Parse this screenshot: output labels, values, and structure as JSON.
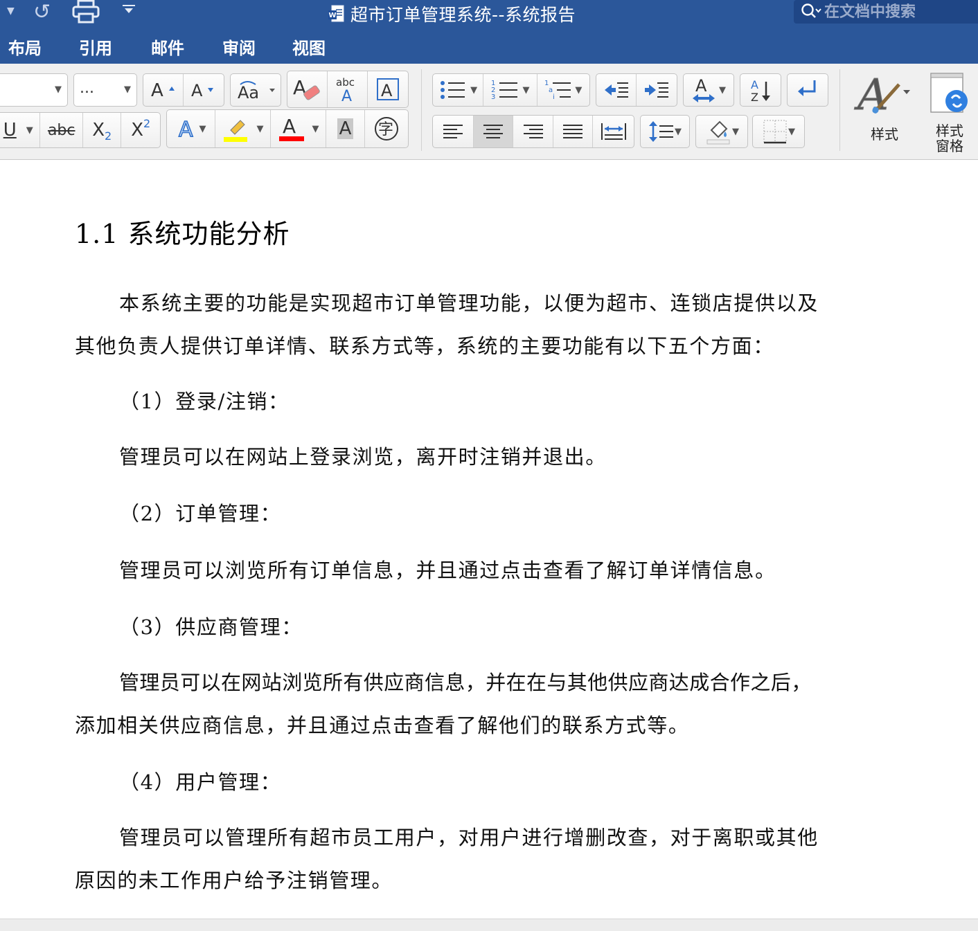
{
  "window": {
    "title": "超市订单管理系统--系统报告",
    "search_placeholder": "在文档中搜索"
  },
  "ribbon_tabs": [
    "布局",
    "引用",
    "邮件",
    "审阅",
    "视图"
  ],
  "font": {
    "size_value": "..."
  },
  "styles": {
    "label": "样式",
    "pane_label_line1": "样式",
    "pane_label_line2": "窗格"
  },
  "colors": {
    "brand": "#2b579a",
    "highlight": "#ffff00",
    "font_color": "#ff0000",
    "shade_icon": "#4a90d9"
  },
  "icons": [
    "dropdown-arrow-icon",
    "redo-icon",
    "print-icon",
    "customize-toolbar-icon",
    "word-doc-icon",
    "search-icon",
    "grow-font-icon",
    "shrink-font-icon",
    "change-case-icon",
    "clear-formatting-icon",
    "phonetic-guide-icon",
    "character-border-icon",
    "underline-icon",
    "strikethrough-icon",
    "subscript-icon",
    "superscript-icon",
    "text-effects-icon",
    "highlight-icon",
    "font-color-icon",
    "character-shading-icon",
    "enclose-characters-icon",
    "bullets-icon",
    "numbering-icon",
    "multilevel-list-icon",
    "decrease-indent-icon",
    "increase-indent-icon",
    "asian-layout-icon",
    "sort-icon",
    "show-marks-icon",
    "align-left-icon",
    "center-icon",
    "align-right-icon",
    "justify-icon",
    "distributed-icon",
    "line-spacing-icon",
    "shading-icon",
    "borders-icon",
    "styles-icon",
    "styles-pane-icon"
  ],
  "document": {
    "heading": "1.1  系统功能分析",
    "paragraphs": [
      "本系统主要的功能是实现超市订单管理功能，以便为超市、连锁店提供以及",
      "其他负责人提供订单详情、联系方式等，系统的主要功能有以下五个方面：",
      "（1）登录/注销：",
      "管理员可以在网站上登录浏览，离开时注销并退出。",
      "（2）订单管理：",
      "管理员可以浏览所有订单信息，并且通过点击查看了解订单详情信息。",
      "（3）供应商管理：",
      "管理员可以在网站浏览所有供应商信息，并在在与其他供应商达成合作之后，",
      "添加相关供应商信息，并且通过点击查看了解他们的联系方式等。",
      "（4）用户管理：",
      "管理员可以管理所有超市员工用户，对用户进行增删改查，对于离职或其他",
      "原因的未工作用户给予注销管理。"
    ]
  }
}
